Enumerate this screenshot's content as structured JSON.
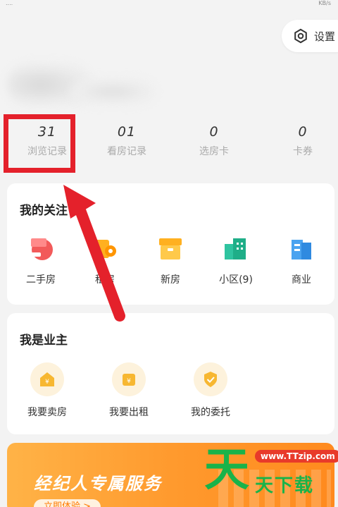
{
  "status_bar": {
    "left": "....",
    "right": "KB/s"
  },
  "settings": {
    "label": "设置"
  },
  "stats": [
    {
      "value": "31",
      "label": "浏览记录"
    },
    {
      "value": "01",
      "label": "看房记录"
    },
    {
      "value": "0",
      "label": "选房卡"
    },
    {
      "value": "0",
      "label": "卡券"
    }
  ],
  "follow": {
    "title": "我的关注",
    "items": [
      {
        "label": "二手房",
        "icon": "second-hand-house-icon"
      },
      {
        "label": "租房",
        "icon": "rent-house-icon"
      },
      {
        "label": "新房",
        "icon": "new-house-icon"
      },
      {
        "label": "小区(9)",
        "icon": "community-icon"
      },
      {
        "label": "商业",
        "icon": "commercial-icon"
      }
    ]
  },
  "owner": {
    "title": "我是业主",
    "items": [
      {
        "label": "我要卖房",
        "icon": "sell-house-icon"
      },
      {
        "label": "我要出租",
        "icon": "rent-out-icon"
      },
      {
        "label": "我的委托",
        "icon": "entrust-icon"
      }
    ]
  },
  "banner": {
    "title": "经纪人专属服务",
    "cta": "立即体验 >"
  },
  "watermark": {
    "big": "天",
    "url": "www.TTzip.com",
    "text": "天下载"
  },
  "colors": {
    "highlight": "#e4212b",
    "accent_orange": "#ff9a2e",
    "watermark_green": "#19b34a"
  }
}
